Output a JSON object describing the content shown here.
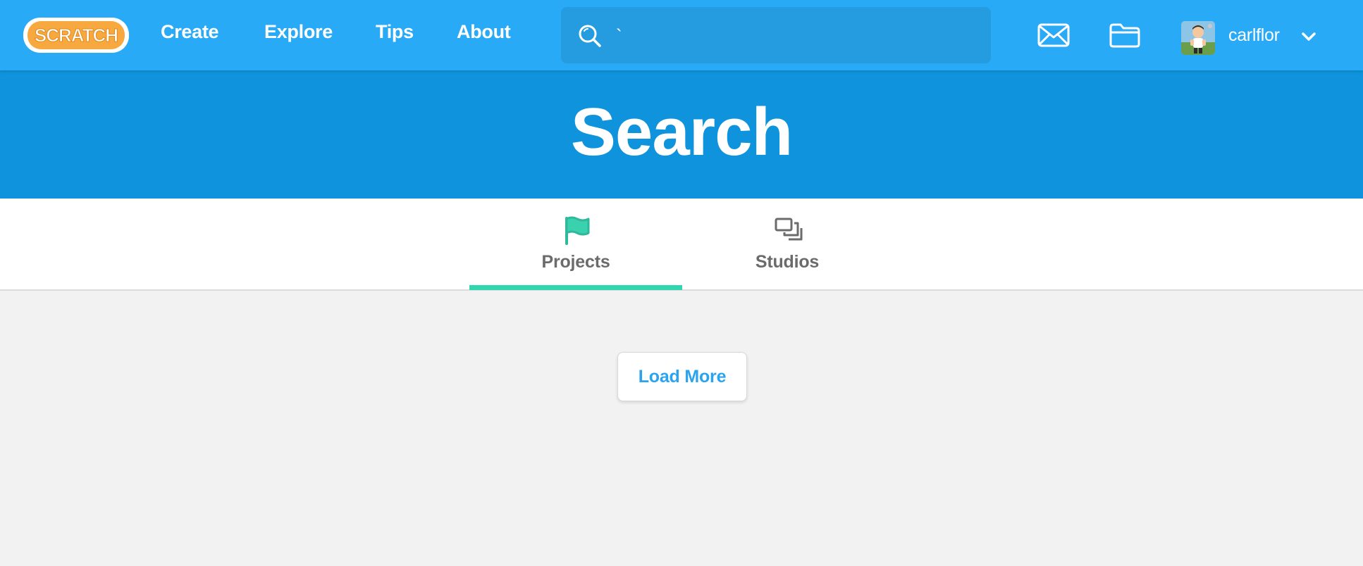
{
  "navbar": {
    "logo_text": "SCRATCH",
    "links": {
      "create": "Create",
      "explore": "Explore",
      "tips": "Tips",
      "about": "About"
    },
    "search": {
      "value": "`",
      "icon": "search-icon"
    },
    "messages_icon": "envelope-icon",
    "my_stuff_icon": "folder-icon",
    "username": "carlflor",
    "dropdown_icon": "chevron-down-icon"
  },
  "banner": {
    "title": "Search"
  },
  "tabs": [
    {
      "label": "Projects",
      "icon": "flag-icon",
      "active": true
    },
    {
      "label": "Studios",
      "icon": "studios-icon",
      "active": false
    }
  ],
  "load_more": {
    "label": "Load More"
  },
  "colors": {
    "navbar_bg": "#29aaf6",
    "banner_bg": "#0e93dc",
    "active_tab_accent": "#2fd6b0",
    "page_bg": "#f2f2f2",
    "load_more_text": "#2aa4ef",
    "logo_orange": "#f7a940"
  }
}
